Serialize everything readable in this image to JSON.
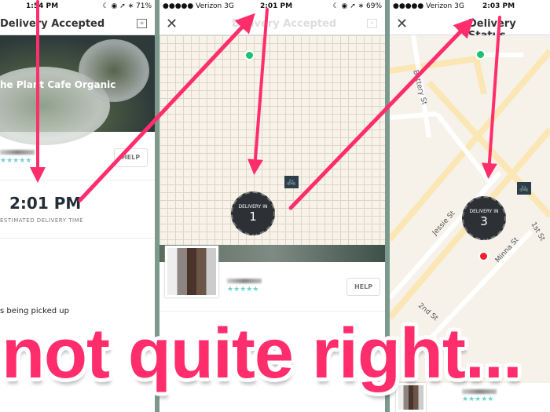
{
  "panel1": {
    "status": {
      "time": "1:54 PM",
      "battery": "☾ ◉ ➚ ∗ 71%"
    },
    "header": {
      "title": "Delivery Accepted"
    },
    "restaurant": "he Plant Cafe Organic",
    "stars": "★★★★★",
    "help": "HELP",
    "eta_time": "2:01 PM",
    "eta_label": "ESTIMATED DELIVERY TIME",
    "status_text": "s being picked up"
  },
  "panel2": {
    "status": {
      "carrier": "●●●●● Verizon  3G",
      "time": "2:01 PM",
      "battery": "☾ ◉ ➚ ∗ 69%"
    },
    "header": {
      "title": "Delivery Accepted"
    },
    "badge": {
      "label": "DELIVERY IN",
      "value": "1"
    },
    "stars": "★★★★★",
    "help": "HELP"
  },
  "panel3": {
    "status": {
      "carrier": "●●●●● Verizon  3G",
      "time": "2:03 PM"
    },
    "header": {
      "title": "Delivery Status"
    },
    "badge": {
      "label": "DELIVERY IN",
      "value": "3"
    },
    "streets": [
      "Battery St",
      "Jessie St",
      "Minna St",
      "1st St",
      "2nd St"
    ],
    "stars": "★★★★★"
  },
  "annotation": {
    "caption": "not quite right...",
    "color": "#ff2d6b"
  },
  "colors": {
    "accent": "#ff2d6b",
    "origin_dot": "#1dc46f",
    "destination_dot": "#f0202c",
    "stars": "#6fd3cf"
  }
}
